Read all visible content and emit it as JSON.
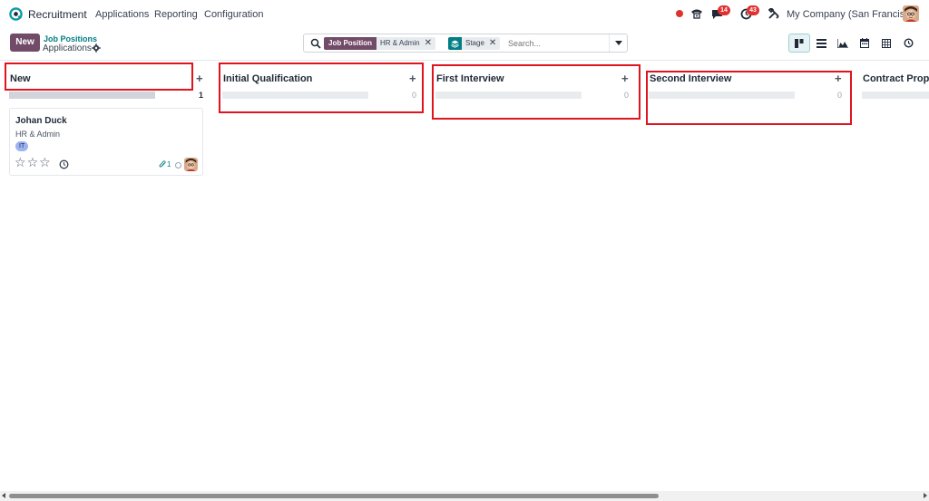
{
  "navbar": {
    "app_name": "Recruitment",
    "menu": [
      "Applications",
      "Reporting",
      "Configuration"
    ],
    "phone_icon": "phone-icon",
    "messages_badge": "14",
    "activities_badge": "43",
    "company": "My Company (San Francisco)"
  },
  "control_panel": {
    "new_label": "New",
    "breadcrumb": "Job Positions",
    "title": "Applications",
    "search": {
      "facets": [
        {
          "label": "Job Position",
          "value": "HR & Admin"
        },
        {
          "label": "",
          "value": "Stage",
          "icon": "layers-icon"
        }
      ],
      "placeholder": "Search..."
    },
    "views": [
      "kanban",
      "list",
      "graph",
      "calendar",
      "pivot",
      "activity"
    ],
    "active_view": "kanban"
  },
  "columns": [
    {
      "title": "New",
      "count": "1",
      "progress": 0.9,
      "highlighted": true
    },
    {
      "title": "Initial Qualification",
      "count": "0",
      "progress": 0,
      "highlighted": true
    },
    {
      "title": "First Interview",
      "count": "0",
      "progress": 0,
      "highlighted": true
    },
    {
      "title": "Second Interview",
      "count": "0",
      "progress": 0,
      "highlighted": true
    },
    {
      "title": "Contract Propo",
      "count": "",
      "progress": 0,
      "highlighted": false
    }
  ],
  "card": {
    "name": "Johan Duck",
    "department": "HR & Admin",
    "tag": "IT",
    "stars": 0,
    "attachments": "1"
  },
  "colors": {
    "brand": "#714b67",
    "accent": "#017e84",
    "highlight": "#e0141e",
    "badge": "#e03131",
    "tag": "#9cb3f3"
  }
}
